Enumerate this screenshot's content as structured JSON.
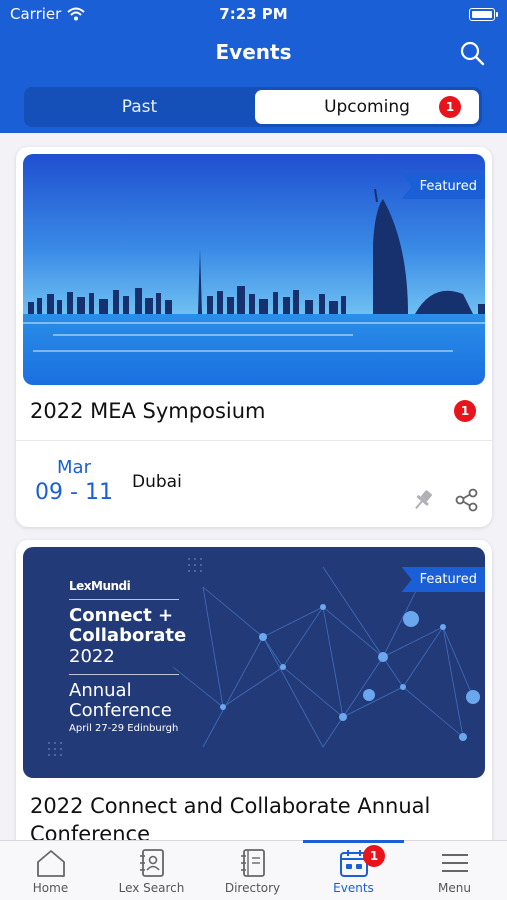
{
  "status_bar": {
    "carrier": "Carrier",
    "time": "7:23 PM"
  },
  "nav": {
    "title": "Events",
    "search_icon": "search-icon"
  },
  "segment": {
    "past_label": "Past",
    "upcoming_label": "Upcoming",
    "upcoming_badge": "1",
    "selected": "Upcoming"
  },
  "events": [
    {
      "featured_label": "Featured",
      "title": "2022 MEA Symposium",
      "badge": "1",
      "month": "Mar",
      "days": "09 - 11",
      "location": "Dubai"
    },
    {
      "featured_label": "Featured",
      "title": "2022 Connect and Collaborate Annual Conference",
      "banner": {
        "brand": "LexMundi",
        "line1": "Connect +",
        "line2": "Collaborate",
        "year": "2022",
        "line3": "Annual",
        "line4": "Conference",
        "dates": "April 27-29 Edinburgh"
      }
    }
  ],
  "tabbar": {
    "items": [
      {
        "label": "Home",
        "icon": "home-icon"
      },
      {
        "label": "Lex Search",
        "icon": "contact-book-icon"
      },
      {
        "label": "Directory",
        "icon": "notebook-icon"
      },
      {
        "label": "Events",
        "icon": "calendar-icon",
        "badge": "1"
      },
      {
        "label": "Menu",
        "icon": "hamburger-menu-icon"
      }
    ],
    "selected": "Events"
  },
  "colors": {
    "brand_blue": "#1a5fd6",
    "badge_red": "#e8131b",
    "banner2_navy": "#233a78"
  }
}
